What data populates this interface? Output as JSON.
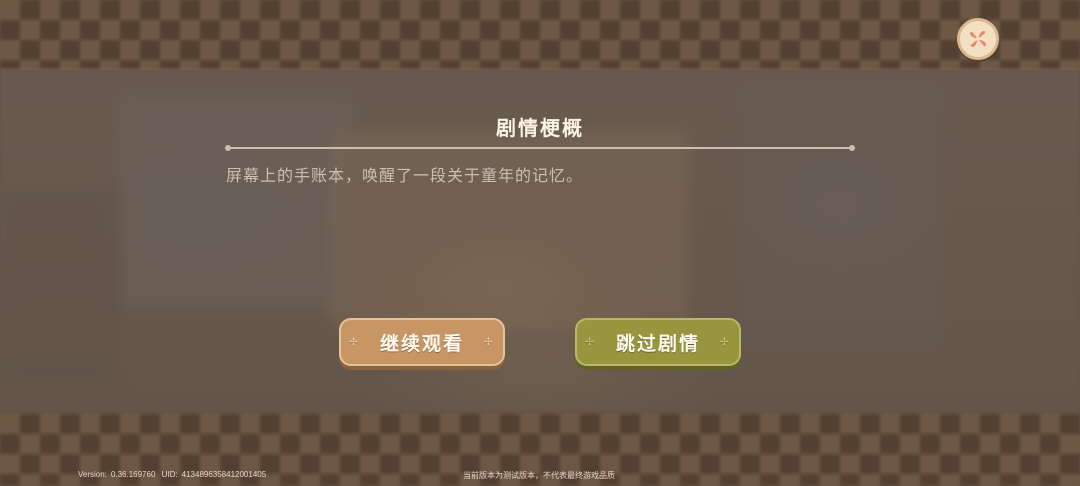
{
  "story": {
    "title": "剧情梗概",
    "synopsis": "屏幕上的手账本，唤醒了一段关于童年的记忆。"
  },
  "buttons": {
    "continue_label": "继续观看",
    "skip_label": "跳过剧情",
    "close_icon": "close-flower-icon"
  },
  "footer": {
    "version_label": "Version:",
    "version": "0.36.169760",
    "uid_label": "UID:",
    "uid": "4134896358412001405",
    "notice": "当前版本为测试版本，不代表最终游戏品质"
  },
  "colors": {
    "continue_button": "#c89665",
    "skip_button": "#98953e",
    "close_icon": "#e7856d"
  }
}
